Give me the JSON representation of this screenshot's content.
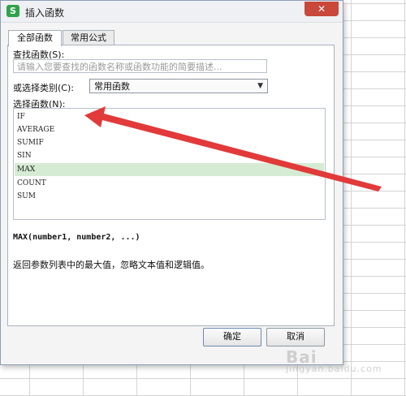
{
  "window": {
    "title": "插入函数",
    "app_icon": "S",
    "close_label": "✕"
  },
  "tabs": [
    {
      "label": "全部函数"
    },
    {
      "label": "常用公式"
    }
  ],
  "search": {
    "label": "查找函数(S):",
    "placeholder": "请输入您要查找的函数名称或函数功能的简要描述..."
  },
  "category": {
    "label": "或选择类别(C):",
    "value": "常用函数"
  },
  "function_list": {
    "label": "选择函数(N):",
    "items": [
      "IF",
      "AVERAGE",
      "SUMIF",
      "SIN",
      "MAX",
      "COUNT",
      "SUM"
    ],
    "selected": "MAX"
  },
  "details": {
    "signature": "MAX(number1, number2, ...)",
    "description": "返回参数列表中的最大值，忽略文本值和逻辑值。"
  },
  "buttons": {
    "ok": "确定",
    "cancel": "取消"
  },
  "colors": {
    "annotation_arrow": "#e23a3a",
    "selected_row": "#d6ebd3",
    "close_button": "#c9483a"
  },
  "watermark": {
    "text": "Bai",
    "sub": "jingyan.baidu.com"
  }
}
